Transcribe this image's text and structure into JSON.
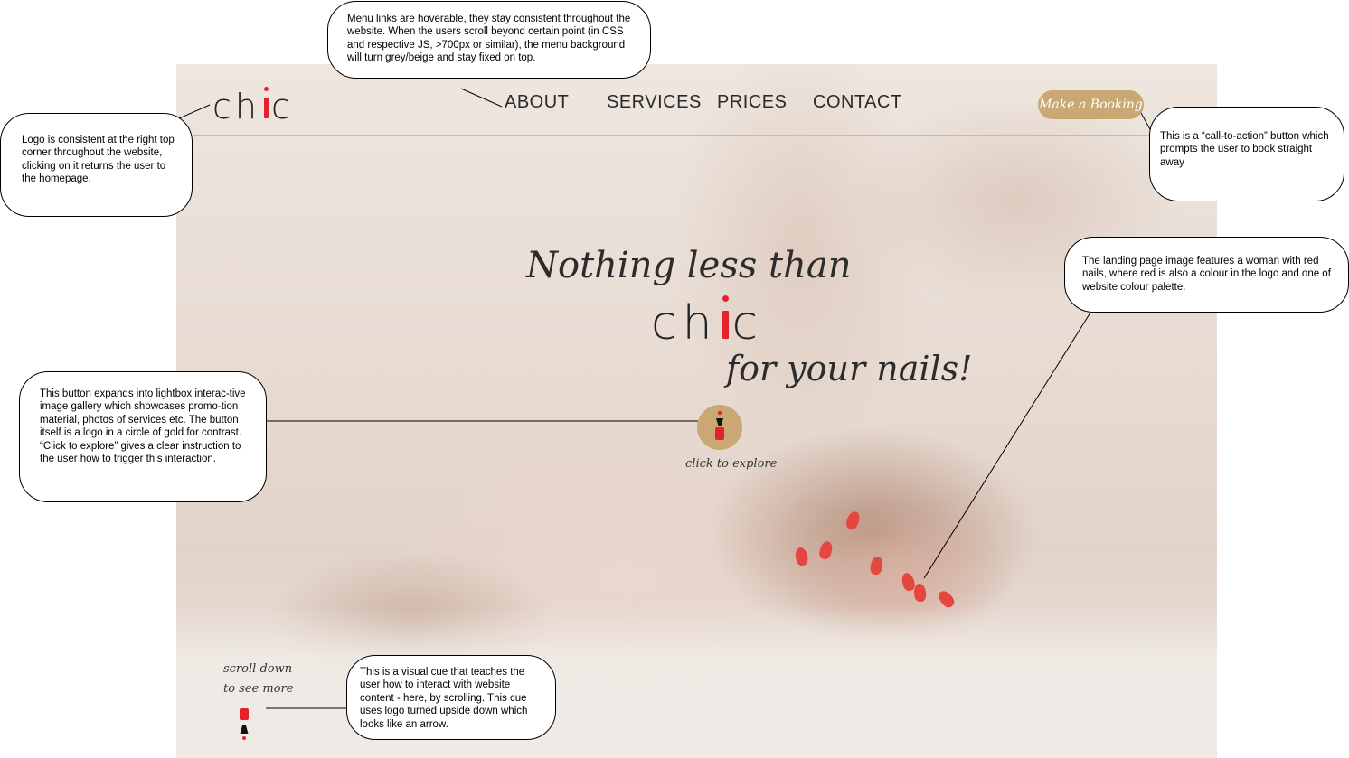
{
  "header": {
    "logo": {
      "prefix": "ch",
      "suffix": "c"
    },
    "menu": [
      "ABOUT",
      "SERVICES",
      "PRICES",
      "CONTACT"
    ],
    "booking_button": "Make a Booking"
  },
  "hero": {
    "tagline_top": "Nothing less than",
    "logo": {
      "prefix": "ch",
      "suffix": "c"
    },
    "tagline_bottom": "for your nails!",
    "explore_label": "click to explore",
    "scroll_line1": "scroll down",
    "scroll_line2": "to see more"
  },
  "colors": {
    "gold": "#c9a874",
    "red": "#e3222c",
    "nail_red": "#e5463f",
    "text": "#2a2a2a"
  },
  "icons": [
    "nail-polish-logo-icon",
    "scroll-arrow-icon"
  ],
  "annotations": {
    "menu": "Menu links are hoverable, they stay consistent throughout the website. When the users scroll beyond certain point (in CSS and respective JS, >700px or similar), the menu background will turn grey/beige and stay fixed on top.",
    "logo": "Logo is consistent at the right top corner throughout the website, clicking on it returns the user to the homepage.",
    "cta": "This is a “call-to-action” button which prompts the user to book straight away",
    "image": "The landing page image features a woman with red nails, where red is also a colour in the logo and one of website colour palette.",
    "explore": "This button expands into lightbox interac-tive image gallery which showcases promo-tion material, photos of services etc. The button itself is a logo in a circle of gold for contrast. “Click to explore” gives a clear instruction to the user how to trigger this interaction.",
    "scroll": "This is a visual cue that teaches the user how to interact with website content - here, by scrolling. This cue uses logo turned upside down which looks like an arrow."
  }
}
